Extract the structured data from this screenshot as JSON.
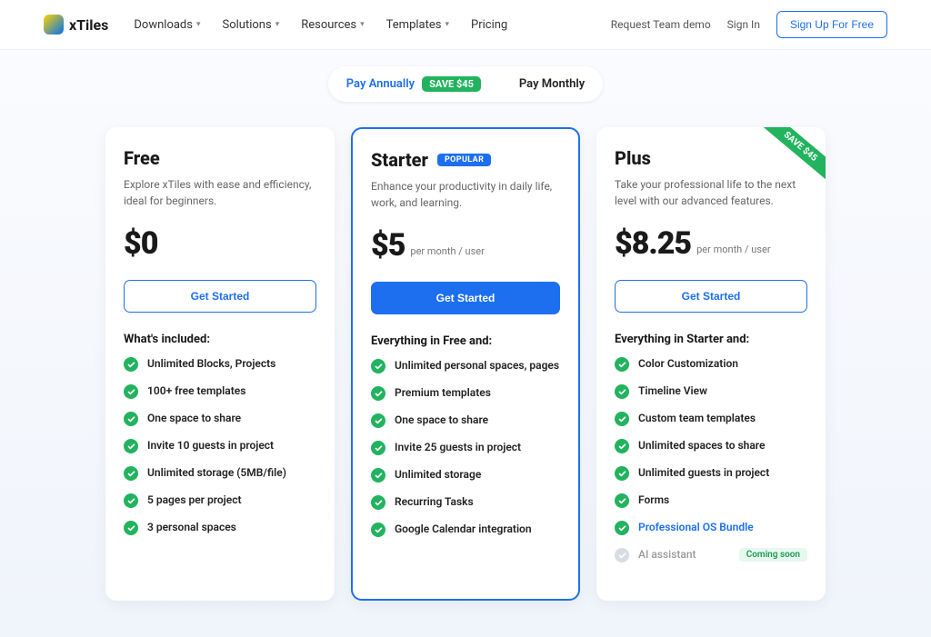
{
  "header": {
    "brand": "xTiles",
    "nav": [
      "Downloads",
      "Solutions",
      "Resources",
      "Templates",
      "Pricing"
    ],
    "nav_has_dropdown": [
      true,
      true,
      true,
      true,
      false
    ],
    "request_demo": "Request Team demo",
    "sign_in": "Sign In",
    "sign_up": "Sign Up For Free"
  },
  "toggle": {
    "annually": "Pay Annually",
    "monthly": "Pay Monthly",
    "save": "SAVE $45"
  },
  "plans": [
    {
      "name": "Free",
      "popular": false,
      "ribbon": null,
      "desc": "Explore xTiles with ease and efficiency, ideal for beginners.",
      "price": "$0",
      "per": "",
      "cta": "Get Started",
      "cta_style": "outline",
      "included_title": "What's included:",
      "features": [
        {
          "text": "Unlimited Blocks, Projects",
          "state": "normal"
        },
        {
          "text": "100+ free templates",
          "state": "normal"
        },
        {
          "text": "One space to share",
          "state": "normal"
        },
        {
          "text": "Invite 10 guests in project",
          "state": "normal"
        },
        {
          "text": "Unlimited storage (5MB/file)",
          "state": "normal"
        },
        {
          "text": "5 pages per project",
          "state": "normal"
        },
        {
          "text": "3 personal spaces",
          "state": "normal"
        }
      ]
    },
    {
      "name": "Starter",
      "popular": true,
      "ribbon": null,
      "desc": "Enhance your productivity in daily life, work, and learning.",
      "price": "$5",
      "per": "per month / user",
      "cta": "Get Started",
      "cta_style": "solid",
      "included_title": "Everything in Free and:",
      "features": [
        {
          "text": "Unlimited personal spaces, pages",
          "state": "normal"
        },
        {
          "text": "Premium templates",
          "state": "normal"
        },
        {
          "text": "One space to share",
          "state": "normal"
        },
        {
          "text": "Invite 25 guests in project",
          "state": "normal"
        },
        {
          "text": "Unlimited storage",
          "state": "normal"
        },
        {
          "text": "Recurring Tasks",
          "state": "normal"
        },
        {
          "text": "Google Calendar integration",
          "state": "normal"
        }
      ]
    },
    {
      "name": "Plus",
      "popular": false,
      "ribbon": "SAVE $45",
      "desc": "Take your professional life to the next level with our advanced features.",
      "price": "$8.25",
      "per": "per month / user",
      "cta": "Get Started",
      "cta_style": "outline",
      "included_title": "Everything in Starter and:",
      "features": [
        {
          "text": "Color Customization",
          "state": "normal"
        },
        {
          "text": "Timeline View",
          "state": "normal"
        },
        {
          "text": "Custom team templates",
          "state": "normal"
        },
        {
          "text": "Unlimited spaces to share",
          "state": "normal"
        },
        {
          "text": "Unlimited guests in project",
          "state": "normal"
        },
        {
          "text": "Forms",
          "state": "normal"
        },
        {
          "text": "Professional OS Bundle",
          "state": "link"
        },
        {
          "text": "AI assistant",
          "state": "coming",
          "badge": "Coming soon"
        }
      ]
    }
  ]
}
